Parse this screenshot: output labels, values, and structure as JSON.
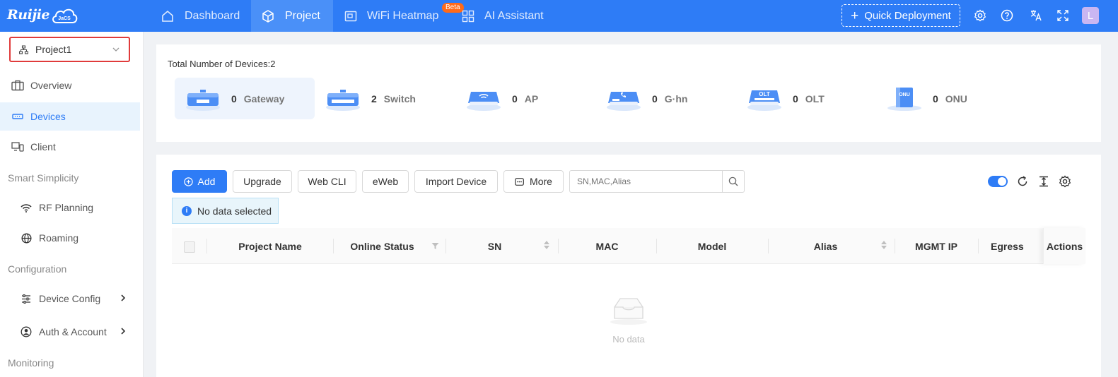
{
  "brand": {
    "logo_text": "Ruijie",
    "logo_badge": "JaCS"
  },
  "topnav": {
    "items": [
      {
        "label": "Dashboard",
        "icon": "home-icon"
      },
      {
        "label": "Project",
        "icon": "cube-icon"
      },
      {
        "label": "WiFi Heatmap",
        "icon": "heatmap-icon"
      },
      {
        "label": "AI Assistant",
        "icon": "grid-icon"
      }
    ],
    "active": "Project",
    "beta_badge": "Beta",
    "quick_deploy": "Quick Deployment",
    "avatar_letter": "L"
  },
  "sidebar": {
    "project_select": "Project1",
    "items": [
      {
        "label": "Overview"
      },
      {
        "label": "Devices"
      },
      {
        "label": "Client"
      }
    ],
    "groups": {
      "smart": "Smart Simplicity",
      "config": "Configuration",
      "monitoring": "Monitoring"
    },
    "smart_items": [
      {
        "label": "RF Planning"
      },
      {
        "label": "Roaming"
      }
    ],
    "config_items": [
      {
        "label": "Device Config"
      },
      {
        "label": "Auth & Account"
      }
    ]
  },
  "summary": {
    "title": "Total Number of Devices:2",
    "devices": [
      {
        "count": "0",
        "name": "Gateway"
      },
      {
        "count": "2",
        "name": "Switch"
      },
      {
        "count": "0",
        "name": "AP"
      },
      {
        "count": "0",
        "name": "G·hn"
      },
      {
        "count": "0",
        "name": "OLT"
      },
      {
        "count": "0",
        "name": "ONU"
      }
    ],
    "device_icon_labels": {
      "olt": "OLT",
      "onu": "ONU"
    }
  },
  "toolbar": {
    "add": "Add",
    "upgrade": "Upgrade",
    "webcli": "Web CLI",
    "eweb": "eWeb",
    "import": "Import Device",
    "more": "More",
    "search_placeholder": "SN,MAC,Alias",
    "no_selection": "No data selected"
  },
  "table": {
    "columns": [
      "Project Name",
      "Online Status",
      "SN",
      "MAC",
      "Model",
      "Alias",
      "MGMT IP",
      "Egress",
      "Actions"
    ],
    "empty_text": "No data"
  },
  "colors": {
    "primary": "#2e7cf6",
    "beta": "#ff6a1a",
    "highlight_border": "#e03b3b"
  }
}
